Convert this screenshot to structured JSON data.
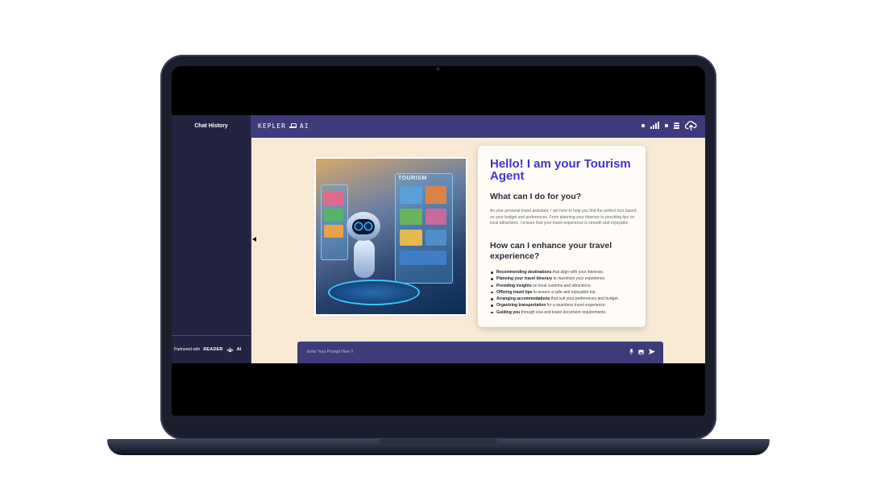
{
  "sidebar": {
    "title": "Chat History",
    "partner_text": "Partnered with",
    "partner_brand": "READER",
    "partner_suffix": "AI"
  },
  "header": {
    "logo_text": "KEPLER",
    "logo_suffix": "AI",
    "icons": [
      "square-icon",
      "signal-icon",
      "square-icon",
      "database-icon",
      "cloud-upload-icon"
    ]
  },
  "hero": {
    "image_label": "TOURISM",
    "heading": "Hello! I am your Tourism Agent",
    "question": "What can I do for you?",
    "intro": "As your personal travel assistant, I am here to help you find the perfect tour based on your budget and preferences. From planning your itinerary to providing tips on local attractions, I ensure that your travel experience is smooth and enjoyable.",
    "enhance_heading": "How can I enhance your travel experience?",
    "features": [
      {
        "bold": "Recommending destinations",
        "rest": " that align with your interests."
      },
      {
        "bold": "Planning your travel itinerary",
        "rest": " to maximize your experience."
      },
      {
        "bold": "Providing insights",
        "rest": " on local customs and attractions."
      },
      {
        "bold": "Offering travel tips",
        "rest": " to ensure a safe and enjoyable trip."
      },
      {
        "bold": "Arranging accommodations",
        "rest": " that suit your preferences and budget."
      },
      {
        "bold": "Organizing transportation",
        "rest": " for a seamless travel experience."
      },
      {
        "bold": "Guiding you",
        "rest": " through visa and travel document requirements."
      }
    ]
  },
  "prompt": {
    "placeholder": "Enter Your Prompt Here !!"
  },
  "colors": {
    "sidebar_bg": "#222441",
    "topbar_bg": "#3e3b7c",
    "content_bg": "#f7e9d4",
    "heading_accent": "#4334c7"
  }
}
